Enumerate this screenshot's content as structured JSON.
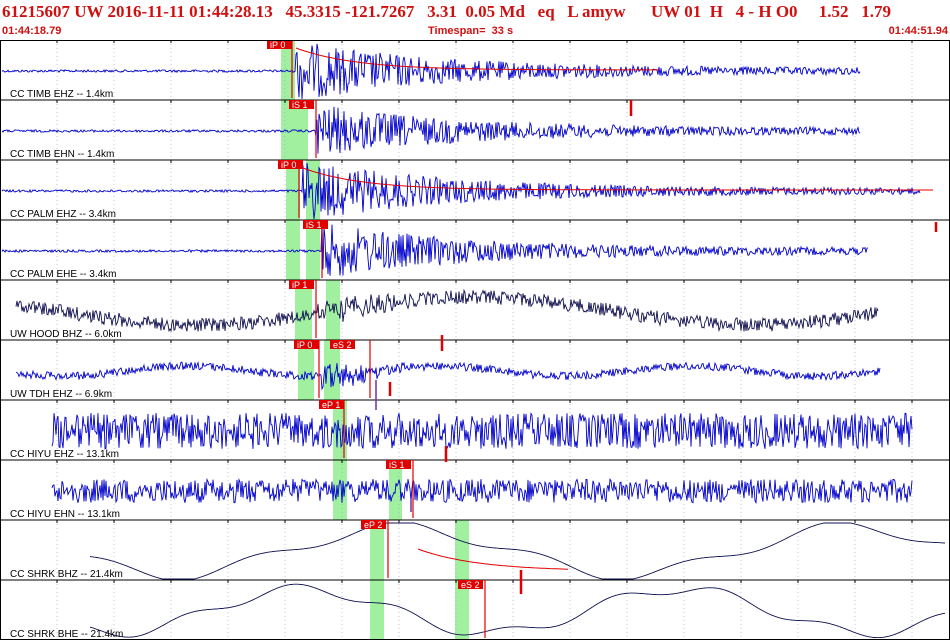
{
  "header": {
    "title": "61215607 UW 2016-11-11 01:44:28.13   45.3315 -121.7267   3.31  0.05 Md   eq   L amyw      UW 01  H   4 - H O0     1.52   1.79",
    "start_time": "01:44:18.79",
    "timespan": "Timespan=  33 s",
    "end_time": "01:44:51.94"
  },
  "colors": {
    "trace_blue": "#0000cc",
    "trace_dark": "#101050",
    "pick_red": "#e00000",
    "window_green": "#a0f0a0",
    "header_red": "#d01010"
  },
  "traces": [
    {
      "label": "CC TIMB EHZ -- 1.4km",
      "color": "blue",
      "picks": [
        {
          "label": "iP 0"
        }
      ]
    },
    {
      "label": "CC TIMB EHN -- 1.4km",
      "color": "blue",
      "picks": [
        {
          "label": "iS 1"
        }
      ]
    },
    {
      "label": "CC PALM EHZ -- 3.4km",
      "color": "blue",
      "picks": [
        {
          "label": "iP 0"
        }
      ]
    },
    {
      "label": "CC PALM EHE -- 3.4km",
      "color": "blue",
      "picks": [
        {
          "label": "iS 1"
        }
      ]
    },
    {
      "label": "UW HOOD BHZ -- 6.0km",
      "color": "dark",
      "picks": [
        {
          "label": "iP 1"
        }
      ]
    },
    {
      "label": "UW TDH EHZ -- 6.9km",
      "color": "blue",
      "picks": [
        {
          "label": "iP 0"
        },
        {
          "label": "eS 2"
        }
      ]
    },
    {
      "label": "CC HIYU EHZ -- 13.1km",
      "color": "blue",
      "picks": [
        {
          "label": "eP 1"
        }
      ]
    },
    {
      "label": "CC HIYU EHN -- 13.1km",
      "color": "blue",
      "picks": [
        {
          "label": "iS 1"
        }
      ]
    },
    {
      "label": "CC SHRK BHZ -- 21.4km",
      "color": "dark",
      "picks": [
        {
          "label": "eP 2"
        }
      ]
    },
    {
      "label": "CC SHRK BHE -- 21.4km",
      "color": "dark",
      "picks": [
        {
          "label": "eS 2"
        }
      ]
    }
  ]
}
